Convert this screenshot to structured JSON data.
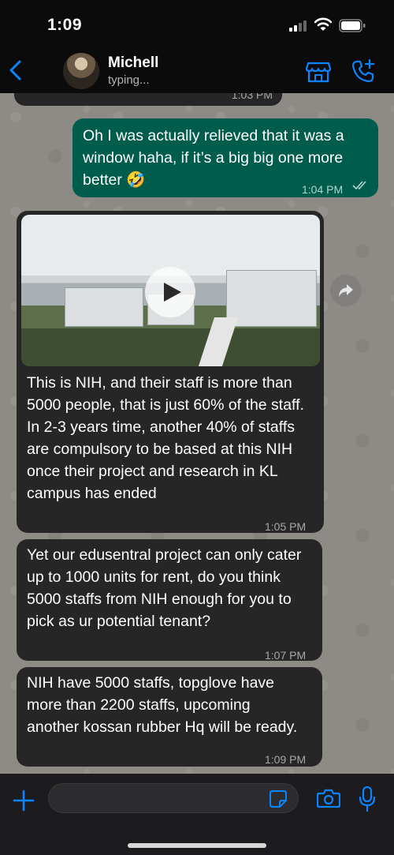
{
  "status_bar": {
    "time": "1:09"
  },
  "header": {
    "contact_name": "Michell",
    "contact_status": "typing..."
  },
  "messages": [
    {
      "direction": "in",
      "text": "",
      "time": "1:03 PM",
      "partial": true
    },
    {
      "direction": "out",
      "text": "Oh I was actually relieved that it was a window haha, if it’s a big big one more better 🤣",
      "time": "1:04 PM",
      "read": true
    },
    {
      "direction": "in",
      "type": "video",
      "text": "This is NIH, and their staff is more than 5000 people, that is just 60% of the staff. In 2-3 years time, another 40% of staffs are compulsory to be based at this NIH once their project and research in KL campus has ended",
      "time": "1:05 PM"
    },
    {
      "direction": "in",
      "text": "Yet our edusentral project can only cater up to 1000 units for rent, do you think 5000 staffs from NIH enough for you to pick as ur potential tenant?",
      "time": "1:07 PM"
    },
    {
      "direction": "in",
      "text": "NIH have 5000 staffs, topglove have more than 2200 staffs, upcoming another kossan rubber Hq will be ready.",
      "time": "1:09 PM"
    }
  ],
  "input": {
    "placeholder": ""
  },
  "colors": {
    "accent": "#0a84ff",
    "incoming_bubble": "#262626",
    "outgoing_bubble": "#005c4b",
    "wallpaper": "#8e8a86"
  },
  "icons": [
    "back-icon",
    "store-icon",
    "add-call-icon",
    "play-icon",
    "forward-icon",
    "plus-icon",
    "sticker-icon",
    "camera-icon",
    "mic-icon"
  ]
}
